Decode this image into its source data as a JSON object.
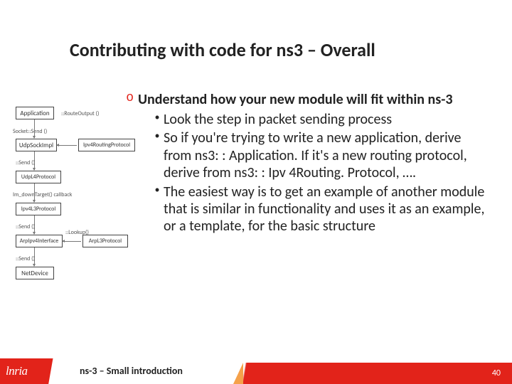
{
  "title": "Contributing with code for ns3 – Overall",
  "diagram": {
    "b0": "Application",
    "b1": "UdpSockImpl",
    "b2": "Ipv4RoutingProtocol",
    "b3": "UdpL4Protocol",
    "b4": "Ipv4L3Protocol",
    "b5": "ArpIpv4Interface",
    "b6": "ArpL3Protocol",
    "b7": "NetDevice",
    "l0": "::RouteOutput ()",
    "l1": "Socket::Send ()",
    "l2": "::Send ()",
    "l3": "Im_downTarget() callback",
    "l4": "::Send ()",
    "l5": "::Lookup()",
    "l6": "::Send ()"
  },
  "bullet_marker": "o",
  "dot_marker": "•",
  "main": "Understand how your new module will fit within ns-3",
  "subs": [
    "Look the step in packet sending process",
    "So if you're trying to write a new application, derive from ns3: : Application. If it's a new routing protocol, derive from ns3: : Ipv 4Routing. Protocol, ….",
    "The easiest way is to get an example of another module that is similar in functionality and uses it as an example, or a template, for the basic structure"
  ],
  "footer": "ns-3 – Small introduction",
  "logo": "lnria",
  "page": "40"
}
